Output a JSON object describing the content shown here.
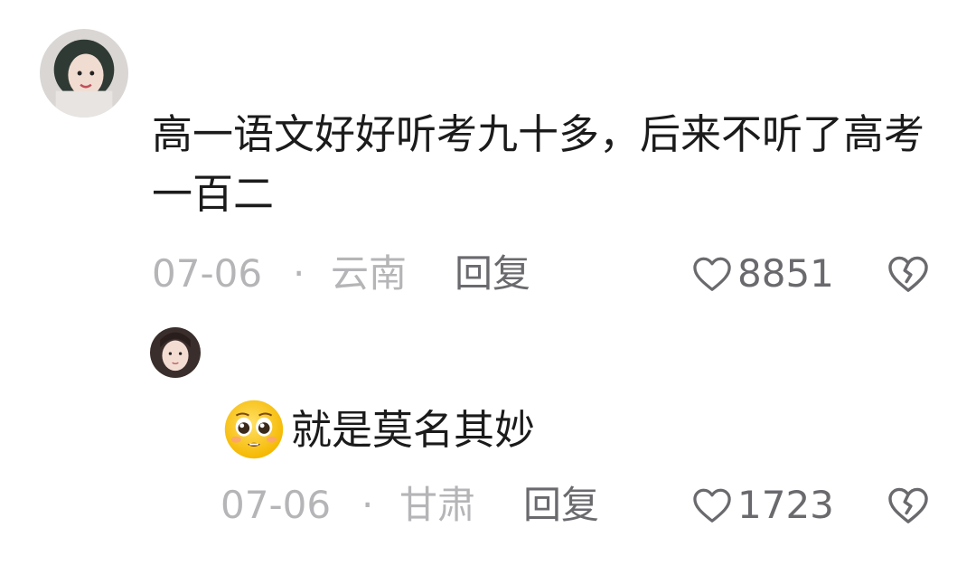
{
  "comment": {
    "avatar_icon": "user-avatar-icon",
    "text": "高一语文好好听考九十多，后来不听了高考一百二",
    "date": "07-06",
    "separator": "·",
    "location": "云南",
    "reply_label": "回复",
    "like_count": "8851",
    "like_icon": "heart-outline-icon",
    "dislike_icon": "broken-heart-icon"
  },
  "reply": {
    "avatar_icon": "user-avatar-icon",
    "emoji_icon": "pleading-face-emoji",
    "text": "就是莫名其妙",
    "date": "07-06",
    "separator": "·",
    "location": "甘肃",
    "reply_label": "回复",
    "like_count": "1723",
    "like_icon": "heart-outline-icon",
    "dislike_icon": "broken-heart-icon"
  },
  "colors": {
    "primary_text": "#1b1b1b",
    "meta_text": "#b5b5b8",
    "action_text": "#6a6a6e"
  }
}
